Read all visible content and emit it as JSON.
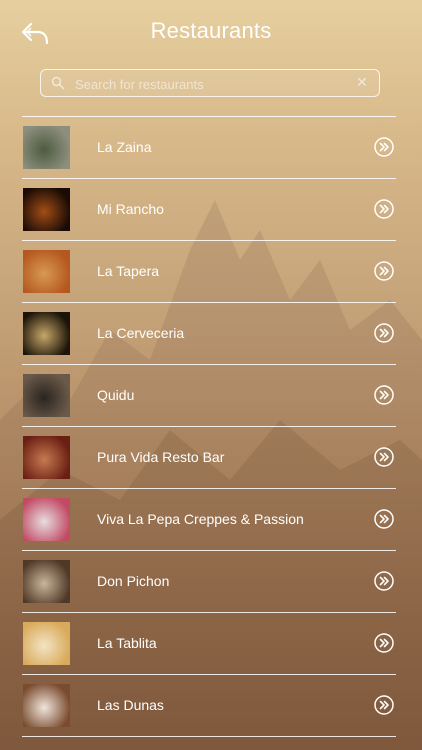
{
  "header": {
    "title": "Restaurants",
    "back_icon": "reply-back-icon"
  },
  "search": {
    "placeholder": "Search for restaurants",
    "value": "",
    "icon": "search-icon",
    "clear_icon": "clear-icon"
  },
  "restaurants": [
    {
      "name": "La Zaina",
      "thumb_colors": [
        "#8c8f7e",
        "#4e5b3f"
      ]
    },
    {
      "name": "Mi Rancho",
      "thumb_colors": [
        "#1a0b05",
        "#a24d16"
      ]
    },
    {
      "name": "La Tapera",
      "thumb_colors": [
        "#b55720",
        "#d79a52"
      ]
    },
    {
      "name": "La Cerveceria",
      "thumb_colors": [
        "#1b1408",
        "#c8a66a"
      ]
    },
    {
      "name": "Quidu",
      "thumb_colors": [
        "#6b5a4a",
        "#2b2520"
      ]
    },
    {
      "name": "Pura Vida Resto Bar",
      "thumb_colors": [
        "#6a1f14",
        "#c77a50"
      ]
    },
    {
      "name": "Viva La Pepa Creppes & Passion",
      "thumb_colors": [
        "#c24b64",
        "#e7dde0"
      ]
    },
    {
      "name": "Don Pichon",
      "thumb_colors": [
        "#4f3826",
        "#c9b59a"
      ]
    },
    {
      "name": "La Tablita",
      "thumb_colors": [
        "#d9aa5a",
        "#f3e4c4"
      ]
    },
    {
      "name": "Las Dunas",
      "thumb_colors": [
        "#7a4b2e",
        "#efe5dc"
      ]
    }
  ],
  "row_icon": "chevron-double-right-icon",
  "colors": {
    "text": "#ffffff",
    "background_top": "#e6cf9f",
    "background_bottom": "#8b5f40"
  }
}
